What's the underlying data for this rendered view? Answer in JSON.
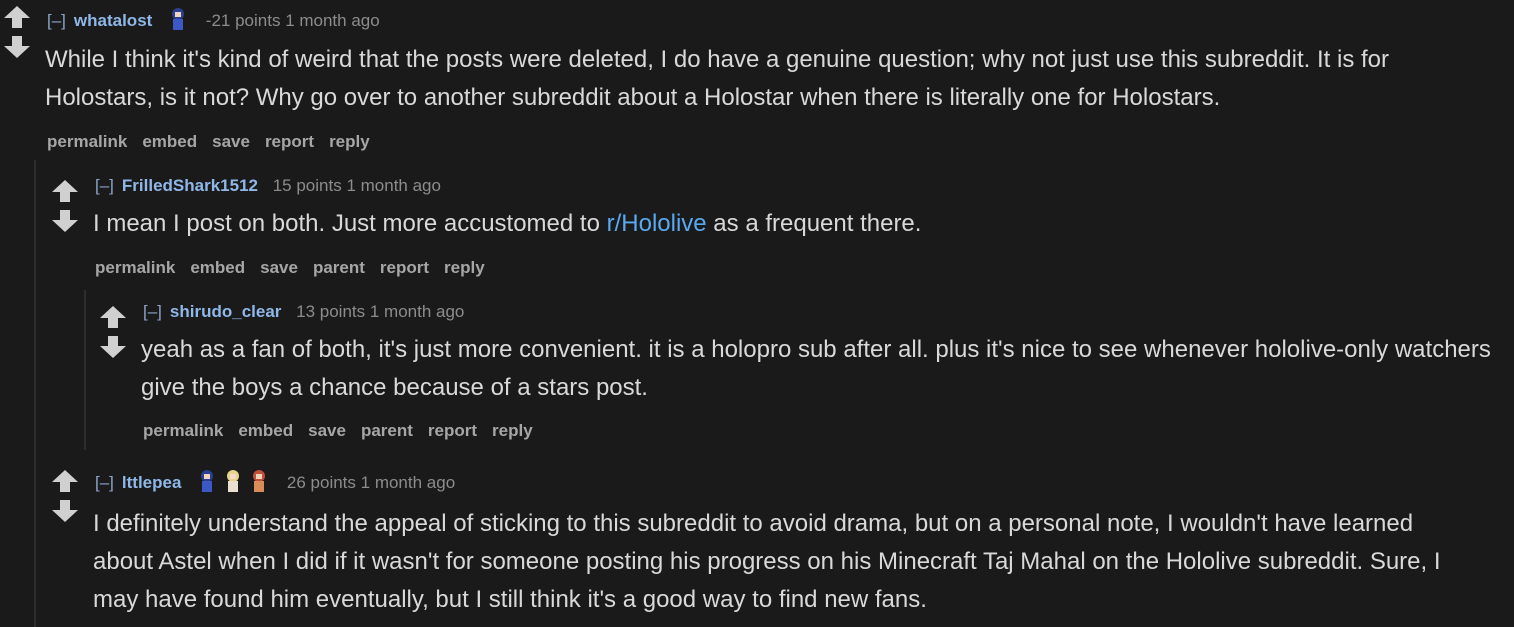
{
  "comments": [
    {
      "toggle": "[–]",
      "author": "whatalost",
      "score": "-21 points",
      "time": "1 month ago",
      "flair_icons": [
        "astel-icon"
      ],
      "body": "While I think it's kind of weird that the posts were deleted, I do have a genuine question; why not just use this subreddit. It is for Holostars, is it not? Why go over to another subreddit about a Holostar when there is literally one for Holostars.",
      "buttons": [
        "permalink",
        "embed",
        "save",
        "report",
        "reply"
      ]
    },
    {
      "toggle": "[–]",
      "author": "FrilledShark1512",
      "score": "15 points",
      "time": "1 month ago",
      "body_before": "I mean I post on both. Just more accustomed to ",
      "body_link": "r/Hololive",
      "body_after": " as a frequent there.",
      "buttons": [
        "permalink",
        "embed",
        "save",
        "parent",
        "report",
        "reply"
      ]
    },
    {
      "toggle": "[–]",
      "author": "shirudo_clear",
      "score": "13 points",
      "time": "1 month ago",
      "body": "yeah as a fan of both, it's just more convenient. it is a holopro sub after all. plus it's nice to see whenever hololive-only watchers give the boys a chance because of a stars post.",
      "buttons": [
        "permalink",
        "embed",
        "save",
        "parent",
        "report",
        "reply"
      ]
    },
    {
      "toggle": "[–]",
      "author": "lttlepea",
      "score": "26 points",
      "time": "1 month ago",
      "flair_icons": [
        "astel-icon",
        "kanata-icon",
        "temma-icon"
      ],
      "body": "I definitely understand the appeal of sticking to this subreddit to avoid drama, but on a personal note, I wouldn't have learned about Astel when I did if it wasn't for someone posting his progress on his Minecraft Taj Mahal on the Hololive subreddit. Sure, I may have found him eventually, but I still think it's a good way to find new fans."
    }
  ],
  "icons": {
    "upvote": "up-arrow-icon",
    "downvote": "down-arrow-icon"
  },
  "colors": {
    "background": "#1a1a1b",
    "author": "#8fb7e8",
    "link": "#5aa9f0",
    "score": "#8c8c8c"
  }
}
